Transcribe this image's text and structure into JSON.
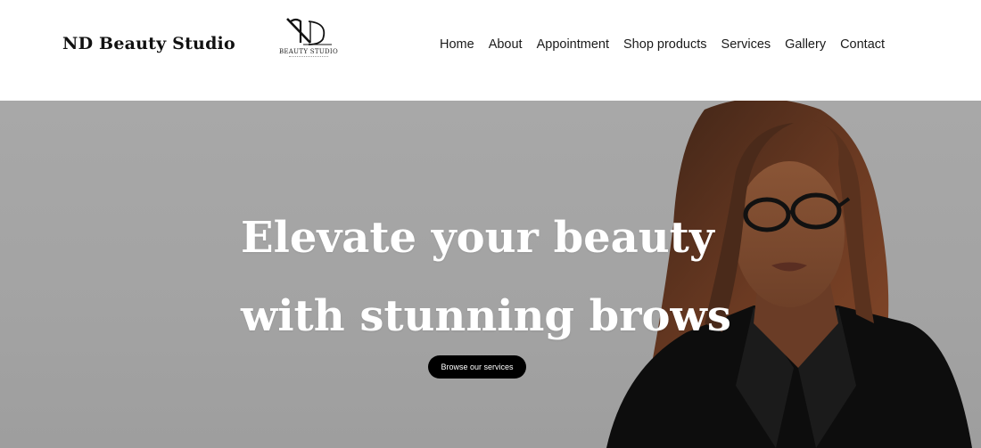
{
  "header": {
    "brand": "ND Beauty Studio",
    "logo": {
      "monogram": "ND",
      "text": "BEAUTY STUDIO"
    },
    "nav": [
      {
        "label": "Home"
      },
      {
        "label": "About"
      },
      {
        "label": "Appointment"
      },
      {
        "label": "Shop products"
      },
      {
        "label": "Services"
      },
      {
        "label": "Gallery"
      },
      {
        "label": "Contact"
      }
    ]
  },
  "hero": {
    "headline_line1": "Elevate your beauty",
    "headline_line2": "with stunning brows",
    "cta_label": "Browse our services",
    "colors": {
      "background": "#a6a6a6",
      "headline": "#ffffff",
      "button": "#000000"
    }
  }
}
